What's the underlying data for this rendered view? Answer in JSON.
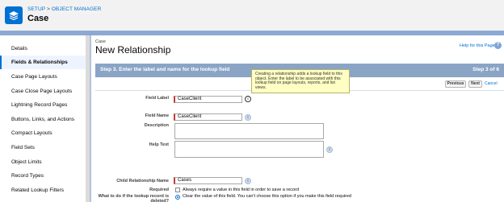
{
  "header": {
    "breadcrumb_setup": "SETUP",
    "breadcrumb_sep": " > ",
    "breadcrumb_object_manager": "OBJECT MANAGER",
    "object_title": "Case"
  },
  "sidebar": {
    "items": [
      {
        "label": "Details"
      },
      {
        "label": "Fields & Relationships"
      },
      {
        "label": "Case Page Layouts"
      },
      {
        "label": "Case Close Page Layouts"
      },
      {
        "label": "Lightning Record Pages"
      },
      {
        "label": "Buttons, Links, and Actions"
      },
      {
        "label": "Compact Layouts"
      },
      {
        "label": "Field Sets"
      },
      {
        "label": "Object Limits"
      },
      {
        "label": "Record Types"
      },
      {
        "label": "Related Lookup Filters"
      }
    ],
    "active_index": 1
  },
  "main": {
    "object_label": "Case",
    "page_title": "New Relationship",
    "help_link": "Help for this Page",
    "help_icon": "?",
    "step_title": "Step 3. Enter the label and name for the lookup field",
    "step_count": "Step 3 of 6",
    "buttons": {
      "previous": "Previous",
      "next": "Next",
      "cancel": "Cancel"
    },
    "tooltip": "Creating a relationship adds a lookup field to this object. Enter the label to be associated with this lookup field on page layouts, reports, and list views.",
    "info_glyph": "i",
    "fields": {
      "field_label": {
        "label": "Field Label",
        "value": "CaseClient"
      },
      "field_name": {
        "label": "Field Name",
        "value": "CaseClient"
      },
      "description": {
        "label": "Description",
        "value": ""
      },
      "help_text": {
        "label": "Help Text",
        "value": ""
      },
      "child_relationship_name": {
        "label": "Child Relationship Name",
        "value": "Cases"
      },
      "required": {
        "label": "Required",
        "option": "Always require a value in this field in order to save a record"
      },
      "lookup_deleted": {
        "label": "What to do if the lookup record is deleted?",
        "option": "Clear the value of this field. You can't choose this option if you make this field required"
      }
    }
  },
  "colors": {
    "brand_blue": "#0070d2",
    "step_bar": "#8aa4c6",
    "required_red": "#c23934",
    "tooltip_bg": "#ffffc4"
  }
}
